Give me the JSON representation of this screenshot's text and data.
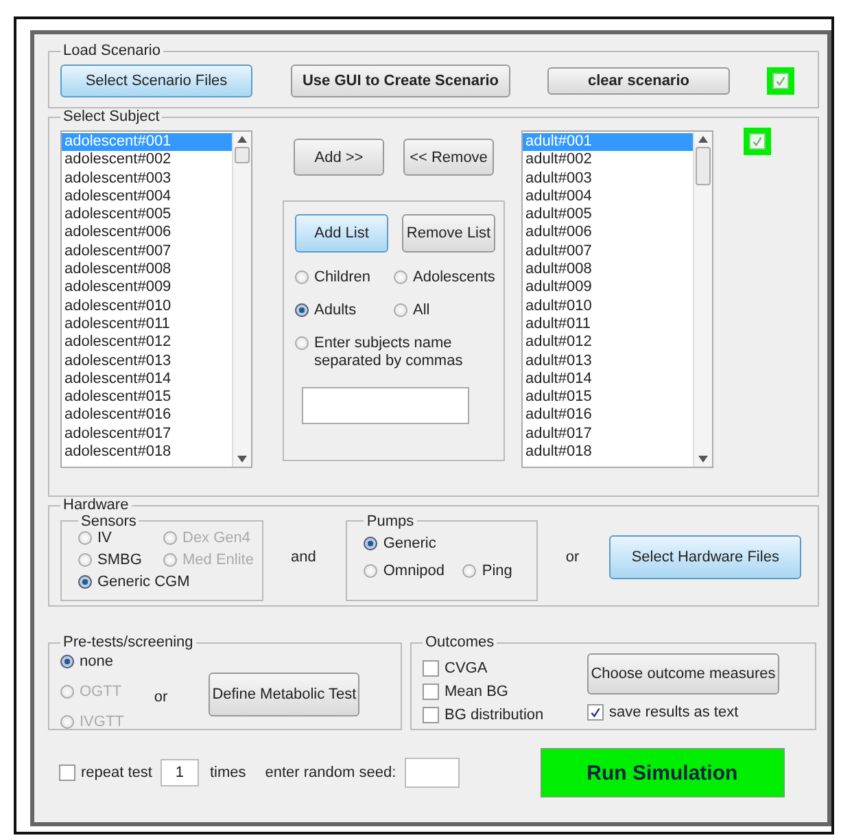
{
  "load_scenario": {
    "title": "Load Scenario",
    "buttons": [
      {
        "label": "Select Scenario Files",
        "kind": "primary"
      },
      {
        "label": "Use GUI to Create Scenario",
        "kind": "bold"
      },
      {
        "label": "clear scenario",
        "kind": "bold"
      }
    ],
    "status_checkbox": {
      "checked": true
    }
  },
  "select_subject": {
    "title": "Select Subject",
    "available": [
      {
        "label": "adolescent#001",
        "selected": true
      },
      {
        "label": "adolescent#002",
        "selected": false
      },
      {
        "label": "adolescent#003",
        "selected": false
      },
      {
        "label": "adolescent#004",
        "selected": false
      },
      {
        "label": "adolescent#005",
        "selected": false
      },
      {
        "label": "adolescent#006",
        "selected": false
      },
      {
        "label": "adolescent#007",
        "selected": false
      },
      {
        "label": "adolescent#008",
        "selected": false
      },
      {
        "label": "adolescent#009",
        "selected": false
      },
      {
        "label": "adolescent#010",
        "selected": false
      },
      {
        "label": "adolescent#011",
        "selected": false
      },
      {
        "label": "adolescent#012",
        "selected": false
      },
      {
        "label": "adolescent#013",
        "selected": false
      },
      {
        "label": "adolescent#014",
        "selected": false
      },
      {
        "label": "adolescent#015",
        "selected": false
      },
      {
        "label": "adolescent#016",
        "selected": false
      },
      {
        "label": "adolescent#017",
        "selected": false
      },
      {
        "label": "adolescent#018",
        "selected": false
      }
    ],
    "add_button": "Add >>",
    "remove_button": "<< Remove",
    "list_panel": {
      "buttons": [
        {
          "label": "Add List",
          "kind": "primary"
        },
        {
          "label": "Remove List",
          "kind": "normal"
        }
      ],
      "options": [
        {
          "label": "Children",
          "selected": false
        },
        {
          "label": "Adolescents",
          "selected": false
        },
        {
          "label": "Adults",
          "selected": true
        },
        {
          "label": "All",
          "selected": false
        },
        {
          "label": "Enter subjects name separated by commas",
          "selected": false
        }
      ]
    },
    "chosen": [
      {
        "label": "adult#001",
        "selected": true
      },
      {
        "label": "adult#002",
        "selected": false
      },
      {
        "label": "adult#003",
        "selected": false
      },
      {
        "label": "adult#004",
        "selected": false
      },
      {
        "label": "adult#005",
        "selected": false
      },
      {
        "label": "adult#006",
        "selected": false
      },
      {
        "label": "adult#007",
        "selected": false
      },
      {
        "label": "adult#008",
        "selected": false
      },
      {
        "label": "adult#009",
        "selected": false
      },
      {
        "label": "adult#010",
        "selected": false
      },
      {
        "label": "adult#011",
        "selected": false
      },
      {
        "label": "adult#012",
        "selected": false
      },
      {
        "label": "adult#013",
        "selected": false
      },
      {
        "label": "adult#014",
        "selected": false
      },
      {
        "label": "adult#015",
        "selected": false
      },
      {
        "label": "adult#016",
        "selected": false
      },
      {
        "label": "adult#017",
        "selected": false
      },
      {
        "label": "adult#018",
        "selected": false
      }
    ],
    "status_checkbox": {
      "checked": true
    }
  },
  "hardware": {
    "title": "Hardware",
    "sensors": {
      "title": "Sensors",
      "options": [
        {
          "label": "IV",
          "selected": false,
          "disabled": false
        },
        {
          "label": "Dex Gen4",
          "selected": false,
          "disabled": true
        },
        {
          "label": "SMBG",
          "selected": false,
          "disabled": false
        },
        {
          "label": "Med Enlite",
          "selected": false,
          "disabled": true
        },
        {
          "label": "Generic CGM",
          "selected": true,
          "disabled": false
        }
      ]
    },
    "and_label": "and",
    "pumps": {
      "title": "Pumps",
      "options": [
        {
          "label": "Generic",
          "selected": true,
          "disabled": false
        },
        {
          "label": "Omnipod",
          "selected": false,
          "disabled": false
        },
        {
          "label": "Ping",
          "selected": false,
          "disabled": false
        }
      ]
    },
    "or_label": "or",
    "button": "Select Hardware Files"
  },
  "pretests": {
    "title": "Pre-tests/screening",
    "options": [
      {
        "label": "none",
        "selected": true,
        "disabled": false
      },
      {
        "label": "OGTT",
        "selected": false,
        "disabled": true
      },
      {
        "label": "IVGTT",
        "selected": false,
        "disabled": true
      }
    ],
    "or_label": "or",
    "button": "Define Metabolic Test"
  },
  "outcomes": {
    "title": "Outcomes",
    "measures": [
      {
        "label": "CVGA",
        "checked": false
      },
      {
        "label": "Mean BG",
        "checked": false
      },
      {
        "label": "BG distribution",
        "checked": false
      }
    ],
    "button": "Choose outcome measures",
    "save_text": {
      "label": "save results as text",
      "checked": true
    }
  },
  "footer": {
    "repeat": {
      "label": "repeat test",
      "checked": false
    },
    "repeat_count": "1",
    "times_label": "times",
    "seed_label": "enter random seed:",
    "run_button": "Run Simulation"
  }
}
